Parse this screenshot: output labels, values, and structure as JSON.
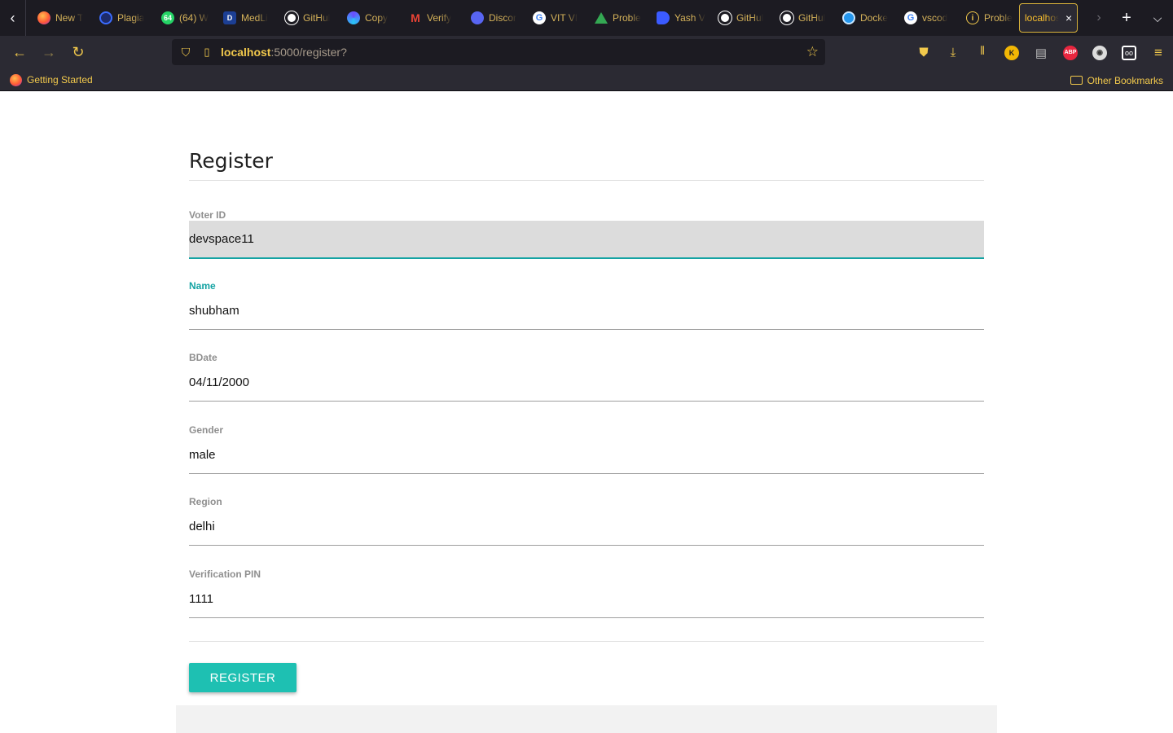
{
  "browser": {
    "tabs": [
      {
        "label": "New T",
        "icon": "firefox-icon",
        "color": "#ff7139"
      },
      {
        "label": "Plagia",
        "icon": "plagiarism-icon",
        "color": "#3b6cff"
      },
      {
        "label": "(64) W",
        "icon": "whatsapp-icon",
        "color": "#25d366",
        "badge": "64"
      },
      {
        "label": "MedLi",
        "icon": "medlife-icon",
        "color": "#1c3f94",
        "badge": "D"
      },
      {
        "label": "GitHul",
        "icon": "github-icon",
        "color": "#ffffff"
      },
      {
        "label": "Copy",
        "icon": "copyai-icon",
        "color": "#6b4cff"
      },
      {
        "label": "Verify",
        "icon": "gmail-icon",
        "color": "#ea4335"
      },
      {
        "label": "Discor",
        "icon": "discord-icon",
        "color": "#5865f2"
      },
      {
        "label": "VIT VI",
        "icon": "google-icon",
        "color": "#ffffff"
      },
      {
        "label": "Proble",
        "icon": "google-drive-icon",
        "color": "#34a853"
      },
      {
        "label": "Yash V",
        "icon": "docs-icon",
        "color": "#3b5bff"
      },
      {
        "label": "GitHul",
        "icon": "github-icon",
        "color": "#ffffff"
      },
      {
        "label": "GitHul",
        "icon": "github-icon",
        "color": "#ffffff"
      },
      {
        "label": "Docke",
        "icon": "docker-icon",
        "color": "#2496ed"
      },
      {
        "label": "vscod",
        "icon": "google-icon",
        "color": "#ffffff"
      },
      {
        "label": "Proble",
        "icon": "info-icon",
        "color": "#f2c94c"
      }
    ],
    "active_tab": {
      "label": "localhost",
      "close": "×"
    },
    "url_host": "localhost",
    "url_rest": ":5000/register?",
    "bookmark": "Getting Started",
    "other_bookmarks": "Other Bookmarks",
    "ext_k": "K",
    "ext_abp": "ABP"
  },
  "form": {
    "title": "Register",
    "fields": [
      {
        "label": "Voter ID",
        "value": "devspace11"
      },
      {
        "label": "Name",
        "value": "shubham"
      },
      {
        "label": "BDate",
        "value": "04/11/2000"
      },
      {
        "label": "Gender",
        "value": "male"
      },
      {
        "label": "Region",
        "value": "delhi"
      },
      {
        "label": "Verification PIN",
        "value": "1111"
      }
    ],
    "submit_label": "REGISTER"
  },
  "colors": {
    "accent": "#1ec0b2",
    "label_active": "#14a3a3",
    "chrome_text": "#f2c94c"
  }
}
